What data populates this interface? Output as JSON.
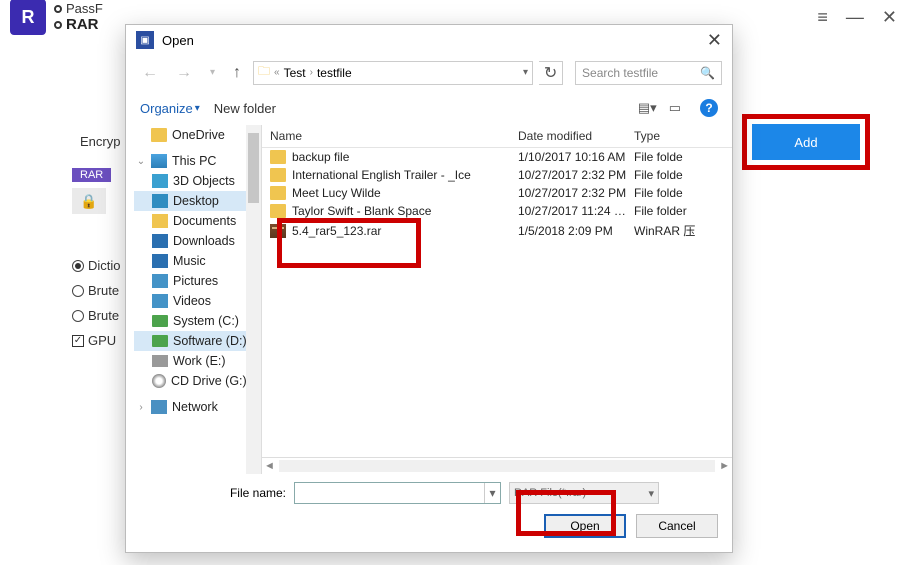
{
  "app": {
    "title_top": "PassF",
    "title_sub": "RAR"
  },
  "win": {
    "menu": "≡",
    "min": "—",
    "close": "✕"
  },
  "side": {
    "encr": "Encryp",
    "rar": "RAR",
    "dict": "Dictio",
    "brute1": "Brute",
    "brute2": "Brute",
    "gpu": "GPU"
  },
  "add_button": "Add",
  "dialog": {
    "title": "Open",
    "path1": "Test",
    "path2": "testfile",
    "search_ph": "Search testfile",
    "organize": "Organize",
    "newfolder": "New folder",
    "cols": {
      "name": "Name",
      "date": "Date modified",
      "type": "Type"
    },
    "tree": {
      "onedrive": "OneDrive",
      "thispc": "This PC",
      "threed": "3D Objects",
      "desktop": "Desktop",
      "documents": "Documents",
      "downloads": "Downloads",
      "music": "Music",
      "pictures": "Pictures",
      "videos": "Videos",
      "systemc": "System (C:)",
      "softwared": "Software (D:)",
      "worke": "Work (E:)",
      "cddrive": "CD Drive (G:)",
      "network": "Network"
    },
    "files": [
      {
        "name": "backup file",
        "date": "1/10/2017 10:16 AM",
        "type": "File folde",
        "kind": "folder"
      },
      {
        "name": "International English Trailer - _Ice",
        "date": "10/27/2017 2:32 PM",
        "type": "File folde",
        "kind": "folder"
      },
      {
        "name": "Meet Lucy Wilde",
        "date": "10/27/2017 2:32 PM",
        "type": "File folde",
        "kind": "folder"
      },
      {
        "name": "Taylor Swift - Blank Space",
        "date": "10/27/2017 11:24 …",
        "type": "File folder",
        "kind": "folder"
      },
      {
        "name": "5.4_rar5_123.rar",
        "date": "1/5/2018 2:09 PM",
        "type": "WinRAR 压",
        "kind": "rar"
      }
    ],
    "filename_label": "File name:",
    "filetype": "RAR File(*.rar)",
    "open": "Open",
    "cancel": "Cancel"
  }
}
